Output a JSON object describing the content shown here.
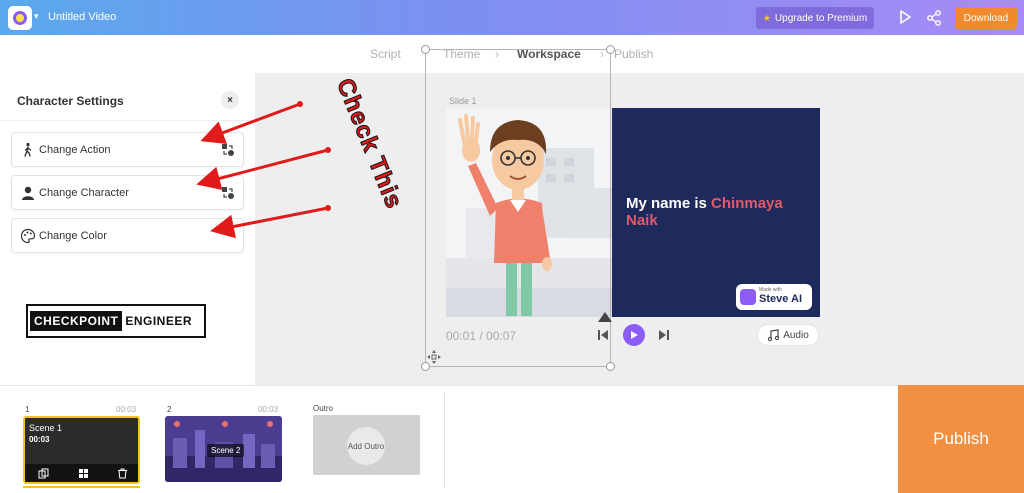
{
  "app": {
    "title": "Untitled Video",
    "logo_icon": "app-logo-icon",
    "upgrade_label": "Upgrade to Premium",
    "download_label": "Download",
    "brand_colors": {
      "accent": "#8b5cf6",
      "download": "#f08a2c",
      "publish": "#ef9043",
      "selected_scene": "#f0c419"
    }
  },
  "steps": [
    {
      "label": "Script",
      "state": "done"
    },
    {
      "label": "Theme",
      "state": "done"
    },
    {
      "label": "Workspace",
      "state": "active"
    },
    {
      "label": "Publish",
      "state": "todo"
    }
  ],
  "panel": {
    "title": "Character Settings",
    "close_label": "×",
    "items": [
      {
        "label": "Change Action",
        "icon": "walk-icon"
      },
      {
        "label": "Change Character",
        "icon": "person-icon"
      },
      {
        "label": "Change Color",
        "icon": "palette-icon"
      }
    ],
    "watermark": {
      "part1": "CHECKPOINT",
      "part2": "ENGINEER"
    }
  },
  "canvas": {
    "slide_label": "Slide 1",
    "slide_text_plain": "My name is ",
    "slide_text_highlight": "Chinmaya Naik",
    "badge_small": "Made with",
    "badge_name": "Steve AI",
    "time": "00:01 / 00:07",
    "audio_label": "Audio"
  },
  "timeline": {
    "scenes": [
      {
        "num": "1",
        "duration": "00:03",
        "title": "Scene 1",
        "inner_duration": "00:03",
        "selected": true
      },
      {
        "num": "2",
        "duration": "00:03",
        "title": "Scene 2",
        "selected": false
      }
    ],
    "outro_label": "Outro",
    "add_outro_label": "Add Outro"
  },
  "publish_label": "Publish",
  "annotation": {
    "text": "Check This"
  }
}
